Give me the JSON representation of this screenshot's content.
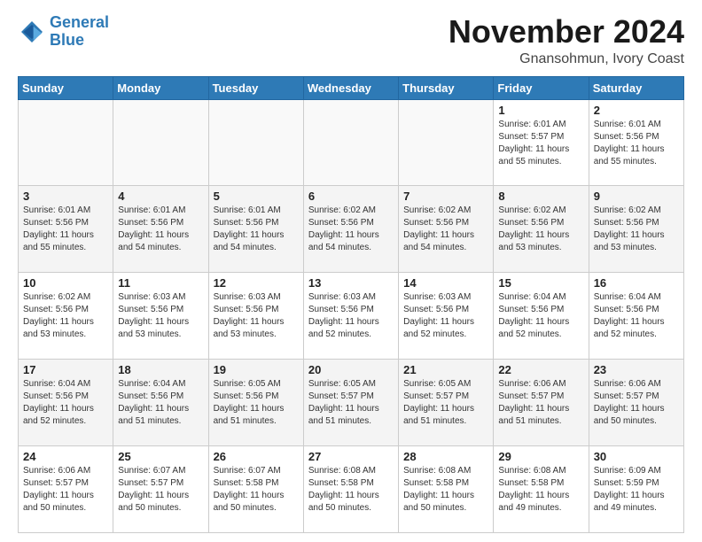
{
  "header": {
    "logo_line1": "General",
    "logo_line2": "Blue",
    "month": "November 2024",
    "location": "Gnansohmun, Ivory Coast"
  },
  "weekdays": [
    "Sunday",
    "Monday",
    "Tuesday",
    "Wednesday",
    "Thursday",
    "Friday",
    "Saturday"
  ],
  "weeks": [
    [
      {
        "day": "",
        "info": ""
      },
      {
        "day": "",
        "info": ""
      },
      {
        "day": "",
        "info": ""
      },
      {
        "day": "",
        "info": ""
      },
      {
        "day": "",
        "info": ""
      },
      {
        "day": "1",
        "info": "Sunrise: 6:01 AM\nSunset: 5:57 PM\nDaylight: 11 hours\nand 55 minutes."
      },
      {
        "day": "2",
        "info": "Sunrise: 6:01 AM\nSunset: 5:56 PM\nDaylight: 11 hours\nand 55 minutes."
      }
    ],
    [
      {
        "day": "3",
        "info": "Sunrise: 6:01 AM\nSunset: 5:56 PM\nDaylight: 11 hours\nand 55 minutes."
      },
      {
        "day": "4",
        "info": "Sunrise: 6:01 AM\nSunset: 5:56 PM\nDaylight: 11 hours\nand 54 minutes."
      },
      {
        "day": "5",
        "info": "Sunrise: 6:01 AM\nSunset: 5:56 PM\nDaylight: 11 hours\nand 54 minutes."
      },
      {
        "day": "6",
        "info": "Sunrise: 6:02 AM\nSunset: 5:56 PM\nDaylight: 11 hours\nand 54 minutes."
      },
      {
        "day": "7",
        "info": "Sunrise: 6:02 AM\nSunset: 5:56 PM\nDaylight: 11 hours\nand 54 minutes."
      },
      {
        "day": "8",
        "info": "Sunrise: 6:02 AM\nSunset: 5:56 PM\nDaylight: 11 hours\nand 53 minutes."
      },
      {
        "day": "9",
        "info": "Sunrise: 6:02 AM\nSunset: 5:56 PM\nDaylight: 11 hours\nand 53 minutes."
      }
    ],
    [
      {
        "day": "10",
        "info": "Sunrise: 6:02 AM\nSunset: 5:56 PM\nDaylight: 11 hours\nand 53 minutes."
      },
      {
        "day": "11",
        "info": "Sunrise: 6:03 AM\nSunset: 5:56 PM\nDaylight: 11 hours\nand 53 minutes."
      },
      {
        "day": "12",
        "info": "Sunrise: 6:03 AM\nSunset: 5:56 PM\nDaylight: 11 hours\nand 53 minutes."
      },
      {
        "day": "13",
        "info": "Sunrise: 6:03 AM\nSunset: 5:56 PM\nDaylight: 11 hours\nand 52 minutes."
      },
      {
        "day": "14",
        "info": "Sunrise: 6:03 AM\nSunset: 5:56 PM\nDaylight: 11 hours\nand 52 minutes."
      },
      {
        "day": "15",
        "info": "Sunrise: 6:04 AM\nSunset: 5:56 PM\nDaylight: 11 hours\nand 52 minutes."
      },
      {
        "day": "16",
        "info": "Sunrise: 6:04 AM\nSunset: 5:56 PM\nDaylight: 11 hours\nand 52 minutes."
      }
    ],
    [
      {
        "day": "17",
        "info": "Sunrise: 6:04 AM\nSunset: 5:56 PM\nDaylight: 11 hours\nand 52 minutes."
      },
      {
        "day": "18",
        "info": "Sunrise: 6:04 AM\nSunset: 5:56 PM\nDaylight: 11 hours\nand 51 minutes."
      },
      {
        "day": "19",
        "info": "Sunrise: 6:05 AM\nSunset: 5:56 PM\nDaylight: 11 hours\nand 51 minutes."
      },
      {
        "day": "20",
        "info": "Sunrise: 6:05 AM\nSunset: 5:57 PM\nDaylight: 11 hours\nand 51 minutes."
      },
      {
        "day": "21",
        "info": "Sunrise: 6:05 AM\nSunset: 5:57 PM\nDaylight: 11 hours\nand 51 minutes."
      },
      {
        "day": "22",
        "info": "Sunrise: 6:06 AM\nSunset: 5:57 PM\nDaylight: 11 hours\nand 51 minutes."
      },
      {
        "day": "23",
        "info": "Sunrise: 6:06 AM\nSunset: 5:57 PM\nDaylight: 11 hours\nand 50 minutes."
      }
    ],
    [
      {
        "day": "24",
        "info": "Sunrise: 6:06 AM\nSunset: 5:57 PM\nDaylight: 11 hours\nand 50 minutes."
      },
      {
        "day": "25",
        "info": "Sunrise: 6:07 AM\nSunset: 5:57 PM\nDaylight: 11 hours\nand 50 minutes."
      },
      {
        "day": "26",
        "info": "Sunrise: 6:07 AM\nSunset: 5:58 PM\nDaylight: 11 hours\nand 50 minutes."
      },
      {
        "day": "27",
        "info": "Sunrise: 6:08 AM\nSunset: 5:58 PM\nDaylight: 11 hours\nand 50 minutes."
      },
      {
        "day": "28",
        "info": "Sunrise: 6:08 AM\nSunset: 5:58 PM\nDaylight: 11 hours\nand 50 minutes."
      },
      {
        "day": "29",
        "info": "Sunrise: 6:08 AM\nSunset: 5:58 PM\nDaylight: 11 hours\nand 49 minutes."
      },
      {
        "day": "30",
        "info": "Sunrise: 6:09 AM\nSunset: 5:59 PM\nDaylight: 11 hours\nand 49 minutes."
      }
    ]
  ]
}
